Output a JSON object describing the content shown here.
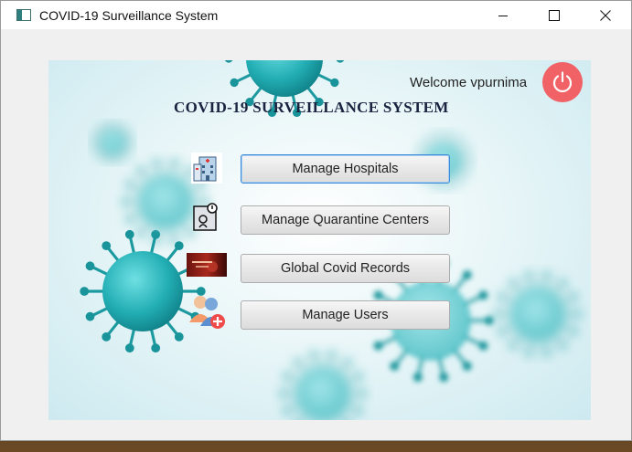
{
  "window": {
    "title": "COVID-19 Surveillance System"
  },
  "header": {
    "welcome": "Welcome vpurnima",
    "heading": "COVID-19 SURVEILLANCE SYSTEM"
  },
  "menu": {
    "items": [
      {
        "label": "Manage Hospitals",
        "icon": "hospital-icon"
      },
      {
        "label": "Manage Quarantine Centers",
        "icon": "quarantine-icon"
      },
      {
        "label": "Global Covid Records",
        "icon": "covid-records-icon"
      },
      {
        "label": "Manage Users",
        "icon": "add-user-icon"
      }
    ]
  },
  "colors": {
    "accent": "#f06266",
    "virus": "#2bb3b8",
    "focus": "#3c8bd6"
  }
}
